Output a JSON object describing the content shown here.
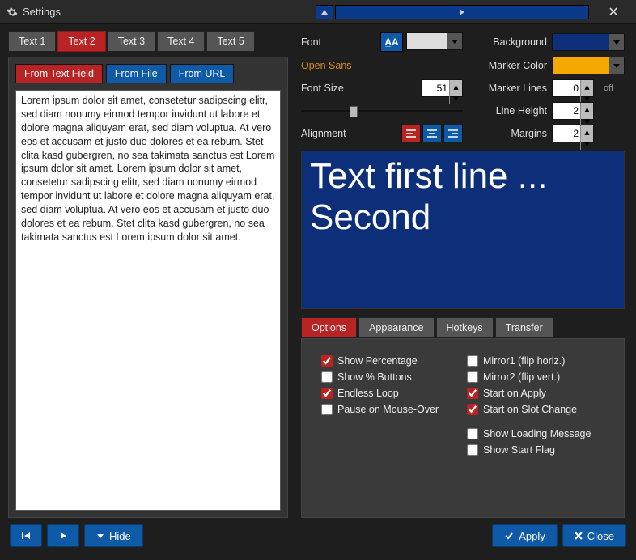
{
  "window": {
    "title": "Settings"
  },
  "tabs": [
    "Text 1",
    "Text 2",
    "Text 3",
    "Text 4",
    "Text 5"
  ],
  "active_tab": "Text 2",
  "source_buttons": {
    "from_field": "From Text Field",
    "from_file": "From File",
    "from_url": "From URL"
  },
  "text_content": "Lorem ipsum dolor sit amet, consetetur sadipscing elitr, sed diam nonumy eirmod tempor invidunt ut labore et dolore magna aliquyam erat, sed diam voluptua. At vero eos et accusam et justo duo dolores et ea rebum. Stet clita kasd gubergren, no sea takimata sanctus est Lorem ipsum dolor sit amet. Lorem ipsum dolor sit amet, consetetur sadipscing elitr, sed diam nonumy eirmod tempor invidunt ut labore et dolore magna aliquyam erat, sed diam voluptua. At vero eos et accusam et justo duo dolores et ea rebum. Stet clita kasd gubergren, no sea takimata sanctus est Lorem ipsum dolor sit amet.",
  "font": {
    "label": "Font",
    "selected_name": "Open Sans",
    "size_label": "Font Size",
    "size_value": 51,
    "alignment_label": "Alignment",
    "alignment": "left"
  },
  "colors": {
    "background_label": "Background",
    "background": "#0d2f7a",
    "marker_label": "Marker Color",
    "marker": "#f5a900"
  },
  "numeric": {
    "marker_lines_label": "Marker Lines",
    "marker_lines": 0,
    "marker_lines_state": "off",
    "line_height_label": "Line Height",
    "line_height": 2,
    "margins_label": "Margins",
    "margins": 2
  },
  "preview_text": "Text first line ... Second",
  "option_tabs": [
    "Options",
    "Appearance",
    "Hotkeys",
    "Transfer"
  ],
  "active_option_tab": "Options",
  "options": {
    "left": [
      {
        "key": "show_pct",
        "label": "Show Percentage",
        "checked": true
      },
      {
        "key": "show_pct_btn",
        "label": "Show % Buttons",
        "checked": false
      },
      {
        "key": "endless",
        "label": "Endless Loop",
        "checked": true
      },
      {
        "key": "pause_hover",
        "label": "Pause on Mouse-Over",
        "checked": false
      }
    ],
    "right": [
      {
        "key": "mirror1",
        "label": "Mirror1 (flip horiz.)",
        "checked": false
      },
      {
        "key": "mirror2",
        "label": "Mirror2 (flip vert.)",
        "checked": false
      },
      {
        "key": "start_apply",
        "label": "Start on Apply",
        "checked": true
      },
      {
        "key": "start_slot",
        "label": "Start on Slot Change",
        "checked": true
      },
      {
        "key": "show_loading",
        "label": "Show Loading Message",
        "checked": false
      },
      {
        "key": "show_flag",
        "label": "Show Start Flag",
        "checked": false
      }
    ]
  },
  "footer": {
    "hide": "Hide",
    "apply": "Apply",
    "close": "Close"
  }
}
